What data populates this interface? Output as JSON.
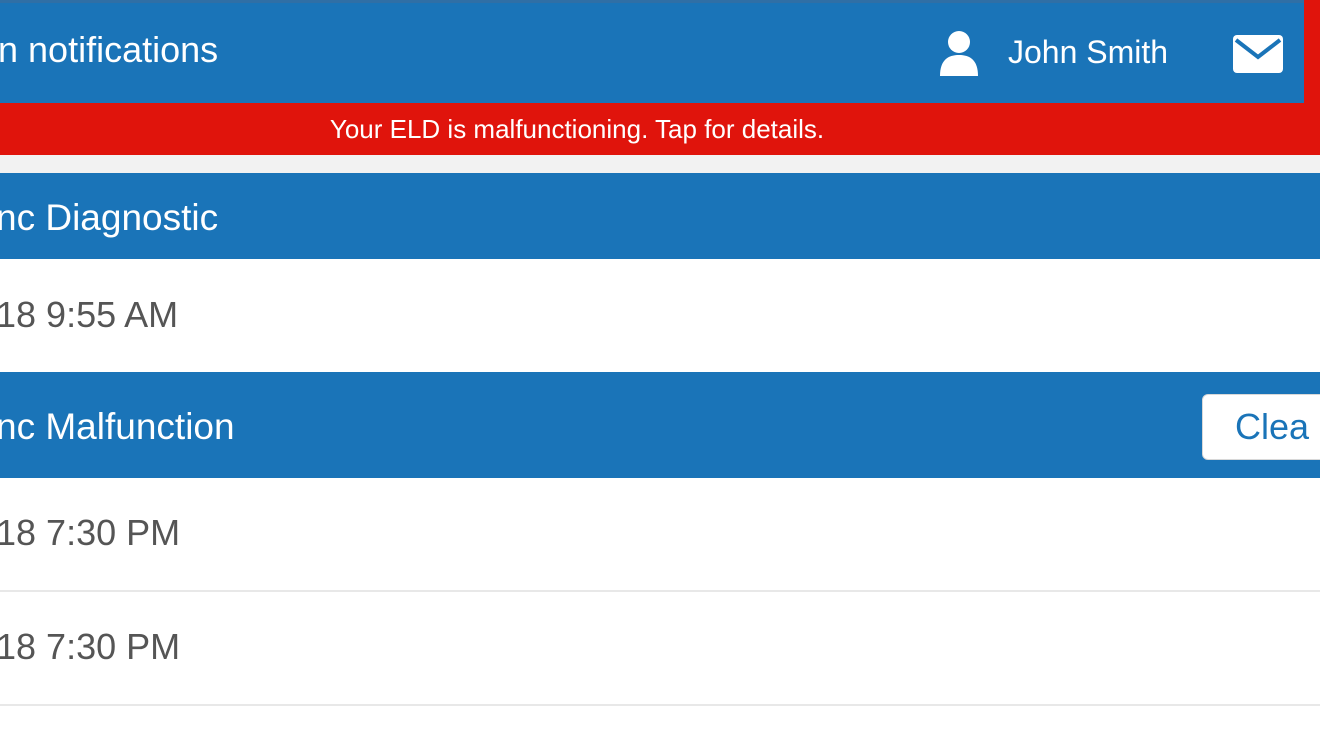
{
  "header": {
    "title": "n notifications",
    "user_name": "John Smith",
    "icons": {
      "user": "user-icon",
      "mail": "mail-icon"
    },
    "colors": {
      "header_bg": "#1a74b8",
      "alert_bg": "#e0140c"
    }
  },
  "alert": {
    "message": "Your ELD is malfunctioning. Tap for details."
  },
  "sections": [
    {
      "title": "nc Diagnostic",
      "rows": [
        {
          "timestamp": "18 9:55 AM"
        }
      ]
    },
    {
      "title": "nc Malfunction",
      "action_label": "Clea",
      "rows": [
        {
          "timestamp": "18 7:30 PM"
        },
        {
          "timestamp": "18 7:30 PM"
        }
      ]
    }
  ]
}
